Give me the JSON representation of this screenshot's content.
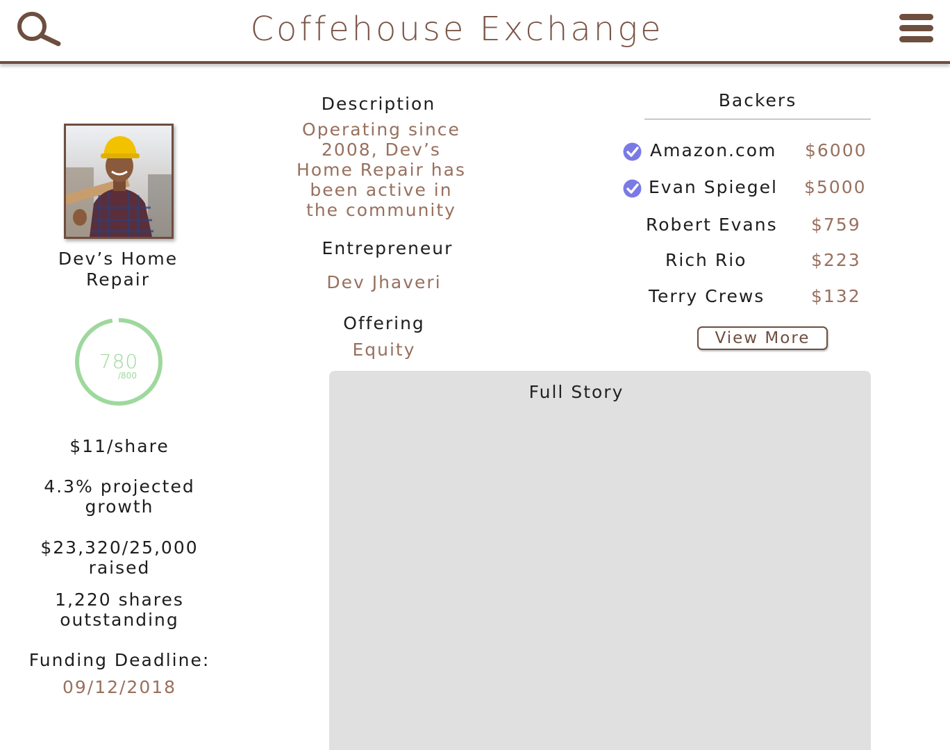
{
  "header": {
    "title": "Coffehouse Exchange",
    "search_icon": "search-icon",
    "menu_icon": "hamburger-menu-icon"
  },
  "business": {
    "name": "Dev’s Home Repair",
    "photo": "photo of contractor in hard hat carrying lumber",
    "score": "780",
    "score_max": "/800",
    "score_fraction": 0.975,
    "price_per_share": "$11/share",
    "projected_growth": "4.3% projected growth",
    "raised": "$23,320/25,000 raised",
    "shares_outstanding": "1,220 shares outstanding",
    "deadline_label": "Funding Deadline:",
    "deadline_value": "09/12/2018"
  },
  "details": {
    "description_label": "Description",
    "description_text": "Operating since 2008, Dev’s Home Repair has been active in the community",
    "entrepreneur_label": "Entrepreneur",
    "entrepreneur_value": "Dev Jhaveri",
    "offering_label": "Offering",
    "offering_value": "Equity"
  },
  "backers": {
    "title": "Backers",
    "items": [
      {
        "name": "Amazon.com",
        "amount": "$6000",
        "verified": true
      },
      {
        "name": "Evan Spiegel",
        "amount": "$5000",
        "verified": true
      },
      {
        "name": "Robert Evans",
        "amount": "$759",
        "verified": false
      },
      {
        "name": "Rich Rio",
        "amount": "$223",
        "verified": false
      },
      {
        "name": "Terry Crews",
        "amount": "$132",
        "verified": false
      }
    ],
    "view_more_label": "View More"
  },
  "story": {
    "title": "Full Story"
  },
  "colors": {
    "brown": "#6e4e3f",
    "accent_text": "#98705e",
    "score_green": "#9ed89e",
    "verified_blue": "#7a7ae6",
    "panel_gray": "#e0e0e0"
  }
}
